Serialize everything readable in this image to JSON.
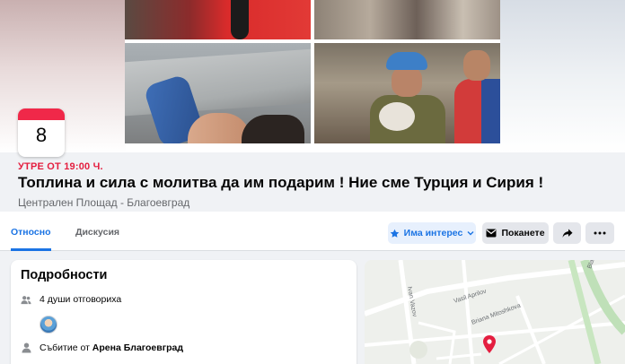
{
  "event": {
    "day": "8",
    "when": "УТРЕ ОТ 19:00 Ч.",
    "title": "Топлина и сила с молитва да им подарим ! Ние сме Турция и Сирия !",
    "place": "Централен Площад - Благоевград"
  },
  "tabs": [
    {
      "label": "Относно",
      "active": true
    },
    {
      "label": "Дискусия",
      "active": false
    }
  ],
  "actions": {
    "interest_label": "Има интерес",
    "invite_label": "Поканете"
  },
  "details": {
    "heading": "Подробности",
    "responded": "4 души отговориха",
    "organizer_prefix": "Събитие от",
    "organizer_name": "Арена Благоевград"
  },
  "map": {
    "streets": [
      "Vasil Aprilov",
      "Briana Mitoshkova",
      "Ivan Vazov",
      "Blatni"
    ]
  },
  "colors": {
    "accent_blue": "#1b74e4",
    "date_red": "#e41e3f",
    "badge_red": "#f02849",
    "pin_red": "#e41e3f"
  },
  "icons": {
    "people": "people-icon",
    "person": "person-icon",
    "star": "star-icon",
    "envelope": "envelope-icon",
    "share": "share-arrow-icon",
    "more": "ellipsis-icon",
    "pin": "map-pin-icon"
  }
}
